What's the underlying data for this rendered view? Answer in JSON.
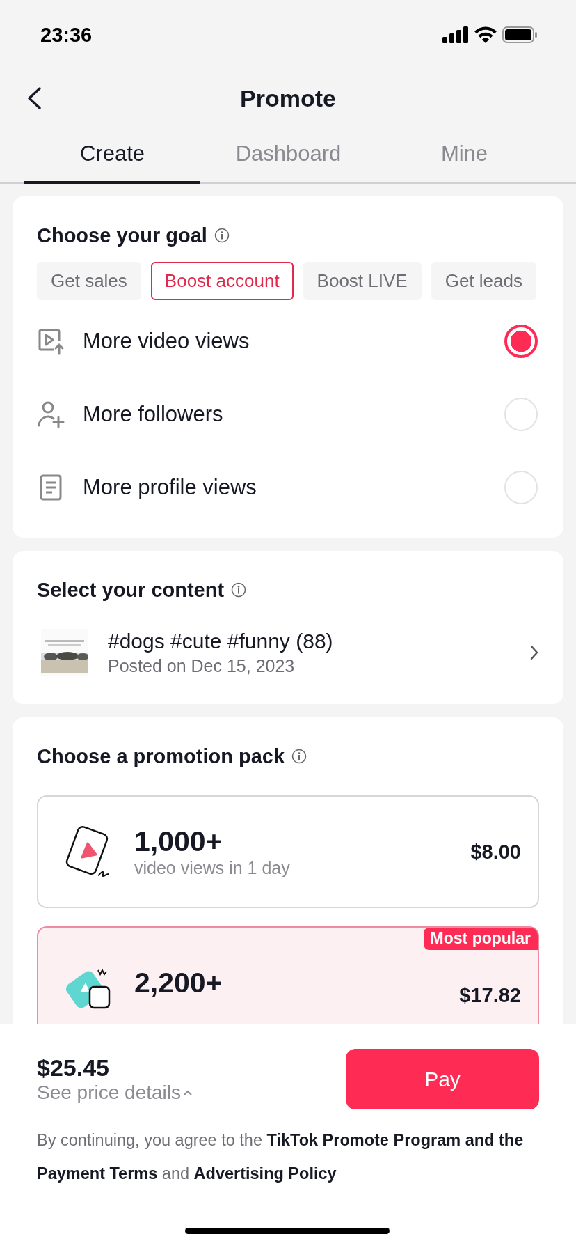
{
  "status_bar": {
    "time": "23:36"
  },
  "header": {
    "title": "Promote"
  },
  "tabs": [
    {
      "label": "Create",
      "selected": true
    },
    {
      "label": "Dashboard",
      "selected": false
    },
    {
      "label": "Mine",
      "selected": false
    }
  ],
  "goal_card": {
    "title": "Choose your goal",
    "goal_types": [
      {
        "label": "Get sales",
        "selected": false
      },
      {
        "label": "Boost account",
        "selected": true
      },
      {
        "label": "Boost LIVE",
        "selected": false
      },
      {
        "label": "Get leads",
        "selected": false
      }
    ],
    "options": [
      {
        "kind": "video",
        "label": "More video views",
        "selected": true
      },
      {
        "kind": "followers",
        "label": "More followers",
        "selected": false
      },
      {
        "kind": "profile",
        "label": "More profile views",
        "selected": false
      }
    ]
  },
  "content_card": {
    "title": "Select your content",
    "video": {
      "title": "#dogs #cute #funny (88)",
      "posted": "Posted on Dec 15, 2023"
    }
  },
  "pack_card": {
    "title": "Choose a promotion pack",
    "packs": [
      {
        "kind": "single",
        "amount": "1,000+",
        "description": "video views in 1 day",
        "price": "$8.00",
        "selected": false
      },
      {
        "kind": "double",
        "amount": "2,200+",
        "badge": "Most popular",
        "price": "$17.82",
        "selected": true
      }
    ]
  },
  "footer": {
    "total": "$25.45",
    "details": "See price details",
    "pay": "Pay",
    "terms": "By continuing, you agree to the **TikTok Promote Program and the Payment Terms** and **Advertising Policy**"
  }
}
